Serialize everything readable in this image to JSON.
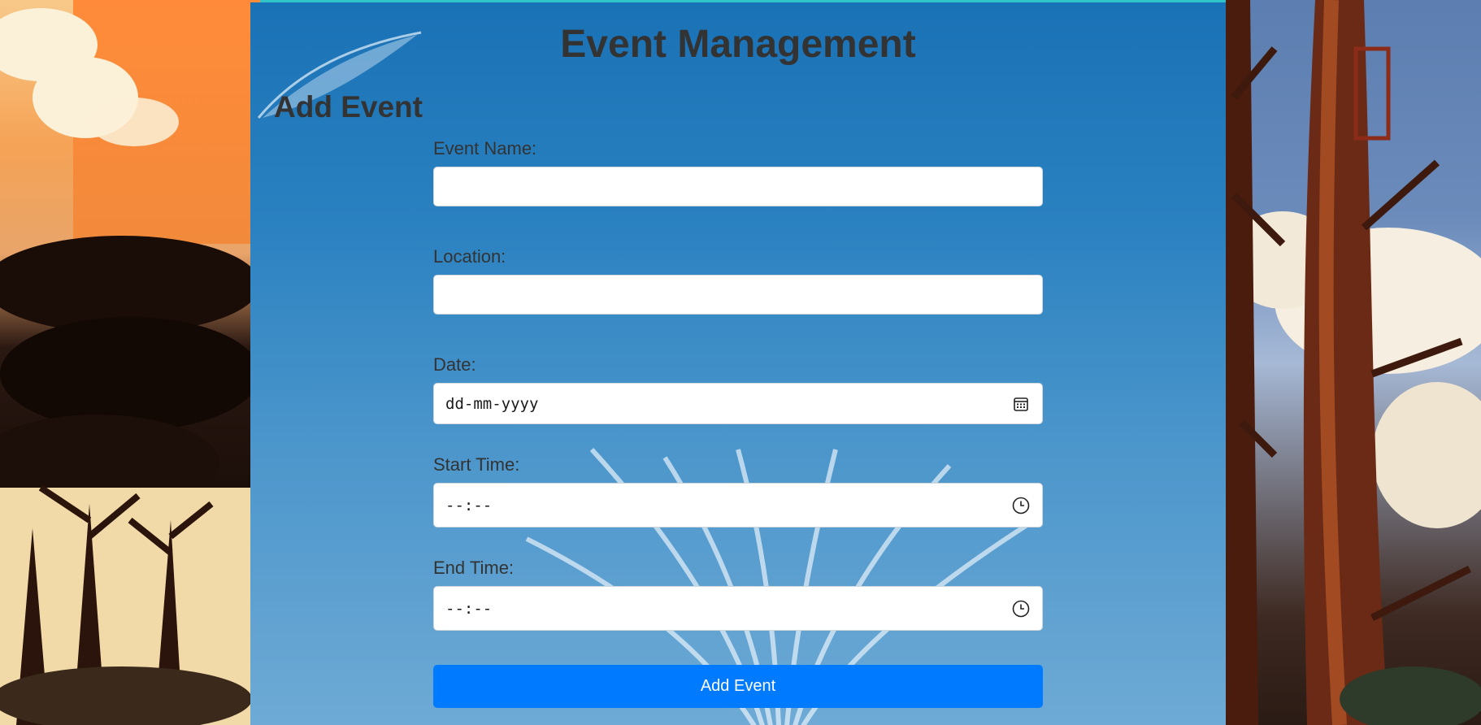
{
  "page": {
    "title": "Event Management"
  },
  "form": {
    "heading": "Add Event",
    "fields": [
      {
        "label": "Event Name:",
        "value": "",
        "type": "text"
      },
      {
        "label": "Location:",
        "value": "",
        "type": "text"
      },
      {
        "label": "Date:",
        "value": "dd-mm-yyyy",
        "type": "date",
        "icon": "calendar-icon"
      },
      {
        "label": "Start Time:",
        "value": "--:--",
        "type": "time",
        "icon": "clock-icon"
      },
      {
        "label": "End Time:",
        "value": "--:--",
        "type": "time",
        "icon": "clock-icon"
      }
    ],
    "submit_label": "Add Event"
  },
  "colors": {
    "panel_top": "#1a72b6",
    "panel_bottom": "#6eaad5",
    "text": "#333333",
    "button": "#007bff",
    "accent": "#30c3c7"
  }
}
